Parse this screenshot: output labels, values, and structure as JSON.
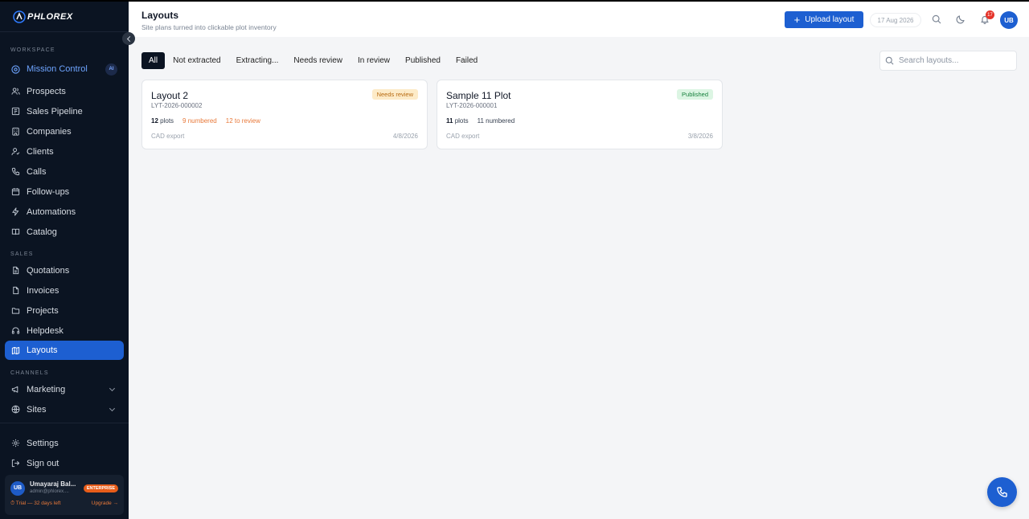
{
  "brand": {
    "name": "PHLOREX",
    "accent": "#1d5fd1"
  },
  "sidebar": {
    "sections": {
      "workspace": "WORKSPACE",
      "sales": "SALES",
      "channels": "CHANNELS"
    },
    "mission_control": {
      "label": "Mission Control",
      "badge": "AI"
    },
    "workspace_items": [
      {
        "label": "Prospects",
        "icon": "users-icon"
      },
      {
        "label": "Sales Pipeline",
        "icon": "pipeline-icon"
      },
      {
        "label": "Companies",
        "icon": "building-icon"
      },
      {
        "label": "Clients",
        "icon": "user-check-icon"
      },
      {
        "label": "Calls",
        "icon": "phone-icon"
      },
      {
        "label": "Follow-ups",
        "icon": "calendar-icon"
      },
      {
        "label": "Automations",
        "icon": "zap-icon"
      },
      {
        "label": "Catalog",
        "icon": "book-icon"
      }
    ],
    "sales_items": [
      {
        "label": "Quotations",
        "icon": "file-icon"
      },
      {
        "label": "Invoices",
        "icon": "receipt-icon"
      },
      {
        "label": "Projects",
        "icon": "folder-icon"
      },
      {
        "label": "Helpdesk",
        "icon": "headset-icon"
      },
      {
        "label": "Layouts",
        "icon": "map-icon",
        "active": true
      }
    ],
    "channel_items": [
      {
        "label": "Marketing",
        "icon": "megaphone-icon"
      },
      {
        "label": "Sites",
        "icon": "globe-icon"
      }
    ],
    "settings_label": "Settings",
    "signout_label": "Sign out",
    "user": {
      "initials": "UB",
      "name": "Umayaraj Bal...",
      "email": "admin@phlorex....",
      "plan": "ENTERPRISE",
      "trial": "⏱ Trial — 32 days left",
      "upgrade": "Upgrade →"
    }
  },
  "header": {
    "title": "Layouts",
    "subtitle": "Site plans turned into clickable plot inventory",
    "upload_label": "Upload layout",
    "date": "17 Aug 2026",
    "notification_count": "17",
    "avatar_initials": "UB"
  },
  "tabs": [
    {
      "label": "All",
      "active": true
    },
    {
      "label": "Not extracted"
    },
    {
      "label": "Extracting..."
    },
    {
      "label": "Needs review"
    },
    {
      "label": "In review"
    },
    {
      "label": "Published"
    },
    {
      "label": "Failed"
    }
  ],
  "search": {
    "placeholder": "Search layouts..."
  },
  "cards": [
    {
      "title": "Layout 2",
      "code": "LYT-2026-000002",
      "plots_count": "12",
      "plots_label": "plots",
      "numbered": "9 numbered",
      "to_review": "12 to review",
      "source": "CAD export",
      "date": "4/8/2026",
      "status": "Needs review"
    },
    {
      "title": "Sample 11 Plot",
      "code": "LYT-2026-000001",
      "plots_count": "11",
      "plots_label": "plots",
      "numbered": "11 numbered",
      "source": "CAD export",
      "date": "3/8/2026",
      "status": "Published"
    }
  ]
}
